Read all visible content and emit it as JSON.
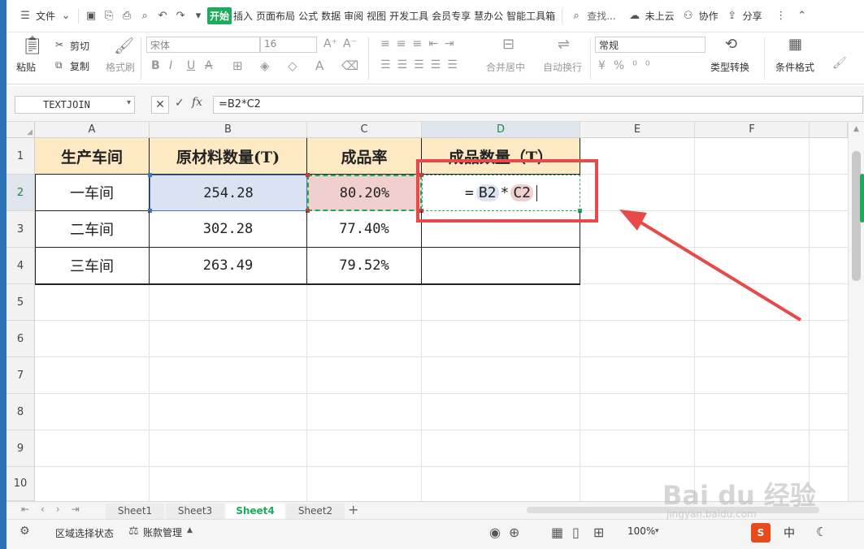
{
  "menu": {
    "file": "文件",
    "tabs": [
      "开始",
      "插入",
      "页面布局",
      "公式",
      "数据",
      "审阅",
      "视图",
      "开发工具",
      "会员专享",
      "慧办公",
      "智能工具箱"
    ],
    "active_tab": "开始",
    "search": "查找...",
    "cloud": "未上云",
    "collab": "协作",
    "share": "分享"
  },
  "ribbon": {
    "paste": "粘贴",
    "cut": "剪切",
    "copy": "复制",
    "format_painter": "格式刷",
    "font": "宋体",
    "size": "16",
    "merge": "合并居中",
    "wrap": "自动换行",
    "number_format": "常规",
    "type_convert": "类型转换",
    "cond_format": "条件格式"
  },
  "formula_bar": {
    "name_box": "TEXTJOIN",
    "formula": "=B2*C2"
  },
  "columns": [
    "A",
    "B",
    "C",
    "D",
    "E",
    "F"
  ],
  "rows": [
    "1",
    "2",
    "3",
    "4",
    "5",
    "6",
    "7",
    "8",
    "9",
    "10"
  ],
  "table": {
    "headers": [
      "生产车间",
      "原材料数量(T)",
      "成品率",
      "成品数量（T）"
    ],
    "rows": [
      [
        "一车间",
        "254.28",
        "80.20%"
      ],
      [
        "二车间",
        "302.28",
        "77.40%"
      ],
      [
        "三车间",
        "263.49",
        "79.52%"
      ]
    ],
    "editing": {
      "eq": "=",
      "ref1": "B2",
      "op": "*",
      "ref2": "C2"
    }
  },
  "sheets": [
    "Sheet1",
    "Sheet3",
    "Sheet4",
    "Sheet2"
  ],
  "active_sheet": "Sheet4",
  "status": {
    "mode": "区域选择状态",
    "ledger": "账款管理",
    "zoom": "100%",
    "ime": "中"
  },
  "watermark": {
    "brand": "Bai du 经验",
    "url": "jingyan.baidu.com"
  },
  "colors": {
    "header_fill": "#fde9c4",
    "ref1_fill": "#dbe3f3",
    "ref2_fill": "#f0cfcf",
    "accent_green": "#1aad5a",
    "annotation_red": "#e84a4a"
  }
}
